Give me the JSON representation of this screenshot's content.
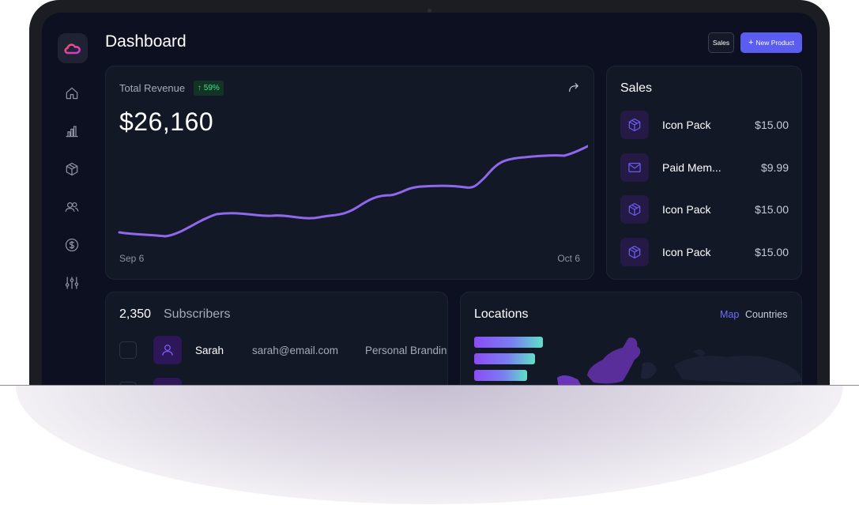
{
  "header": {
    "title": "Dashboard",
    "sales_button": "Sales",
    "new_product_button": "New Product",
    "new_product_icon": "+"
  },
  "sidebar": {
    "items": [
      {
        "icon": "home-icon"
      },
      {
        "icon": "bar-chart-icon"
      },
      {
        "icon": "box-icon"
      },
      {
        "icon": "users-icon"
      },
      {
        "icon": "dollar-icon"
      },
      {
        "icon": "sliders-icon"
      }
    ]
  },
  "revenue": {
    "label": "Total Revenue",
    "change": "↑ 59%",
    "value": "$26,160",
    "start_date": "Sep 6",
    "end_date": "Oct 6"
  },
  "sales": {
    "title": "Sales",
    "items": [
      {
        "icon": "box-icon",
        "name": "Icon Pack",
        "price": "$15.00"
      },
      {
        "icon": "mail-icon",
        "name": "Paid Mem...",
        "price": "$9.99"
      },
      {
        "icon": "box-icon",
        "name": "Icon Pack",
        "price": "$15.00"
      },
      {
        "icon": "box-icon",
        "name": "Icon Pack",
        "price": "$15.00"
      }
    ]
  },
  "subscribers": {
    "count": "2,350",
    "label": "Subscribers",
    "rows": [
      {
        "name": "Sarah",
        "email": "sarah@email.com",
        "topic": "Personal Branding"
      }
    ]
  },
  "locations": {
    "title": "Locations",
    "tabs": [
      "Map",
      "Countries"
    ],
    "active_tab": "Map"
  },
  "colors": {
    "accent": "#5b5cf0",
    "chart_line": "#8f68ec",
    "positive": "#3ee08a",
    "background": "#0c1020",
    "card": "#131827"
  }
}
